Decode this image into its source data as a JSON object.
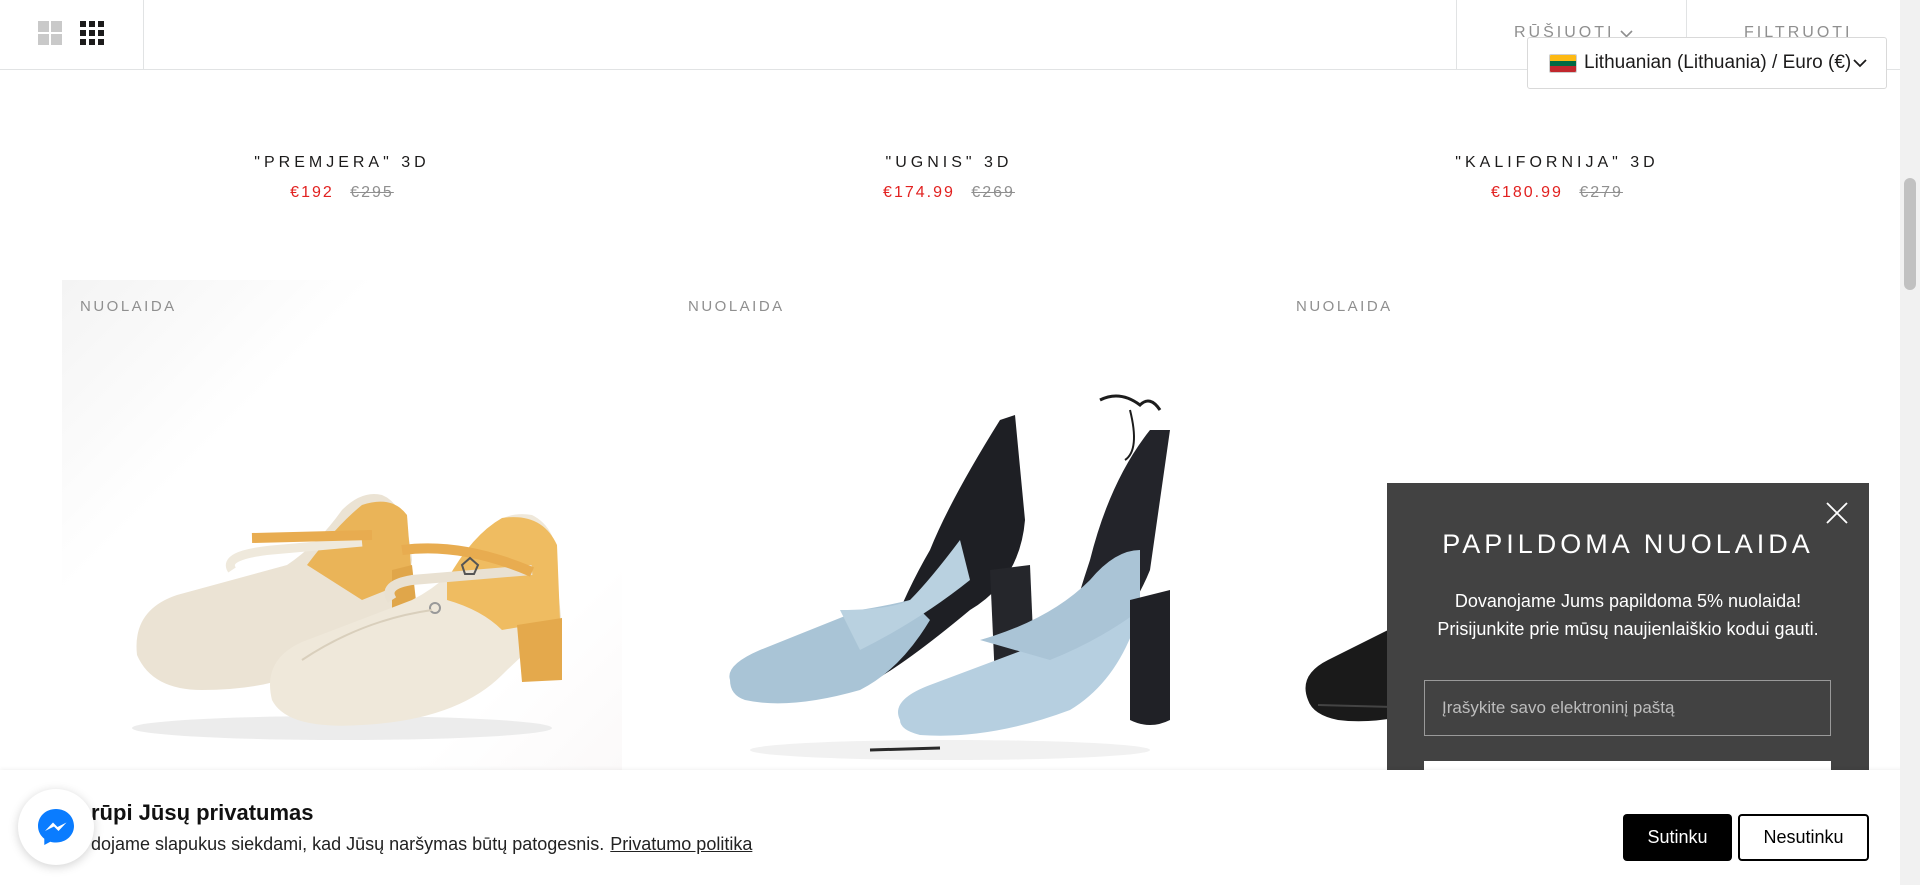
{
  "toolbar": {
    "layout_two_icon": "grid-2-icon",
    "layout_four_icon": "grid-4-icon",
    "sort_label": "RŪŠIUOTI",
    "filter_label": "FILTRUOTI"
  },
  "language_selector": {
    "label": "Lithuanian (Lithuania) / Euro (€)",
    "flag_colors": [
      "#FDB913",
      "#006A44",
      "#C1272D"
    ]
  },
  "products_top": [
    {
      "title": "\"PREMJERA\" 3D",
      "price": "€192",
      "compare_price": "€295"
    },
    {
      "title": "\"UGNIS\" 3D",
      "price": "€174.99",
      "compare_price": "€269"
    },
    {
      "title": "\"KALIFORNIJA\" 3D",
      "price": "€180.99",
      "compare_price": "€279"
    }
  ],
  "products_grid": [
    {
      "badge": "NUOLAIDA",
      "image": "beige-yellow-mary-jane-shoes"
    },
    {
      "badge": "NUOLAIDA",
      "image": "light-blue-black-heeled-pumps"
    },
    {
      "badge": "NUOLAIDA",
      "image": "black-leather-shoe"
    }
  ],
  "newsletter_popup": {
    "title": "PAPILDOMA NUOLAIDA",
    "line1": "Dovanojame Jums papildoma 5% nuolaida!",
    "line2": "Prisijunkite prie mūsų naujienlaiškio kodui gauti.",
    "email_placeholder": "Įrašykite savo elektroninį paštą",
    "close_icon": "close-icon"
  },
  "cookie_banner": {
    "title": "rūpi Jūsų privatumas",
    "text": "dojame slapukus siekdami, kad Jūsų naršymas būtų patogesnis.",
    "link": "Privatumo politika",
    "accept": "Sutinku",
    "decline": "Nesutinku"
  },
  "messenger": {
    "icon": "messenger-icon"
  },
  "colors": {
    "sale_price": "#e22120",
    "muted_text": "#8f8f8f",
    "popup_bg": "#424242",
    "accept_bg": "#000000",
    "messenger_blue": "#0a7cff"
  }
}
